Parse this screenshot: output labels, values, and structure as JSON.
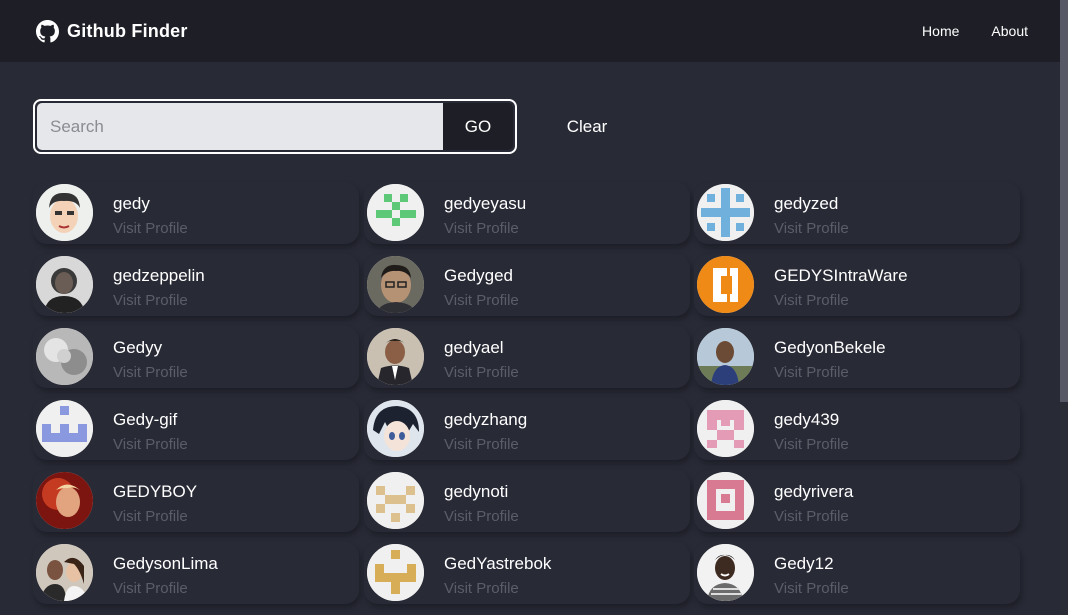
{
  "navbar": {
    "title": "Github Finder",
    "logo_icon": "github-icon",
    "links": [
      {
        "label": "Home"
      },
      {
        "label": "About"
      }
    ]
  },
  "search": {
    "placeholder": "Search",
    "value": "",
    "go_label": "GO",
    "clear_label": "Clear"
  },
  "users": [
    {
      "login": "gedy",
      "link": "Visit Profile",
      "avatar": "cartoon-face"
    },
    {
      "login": "gedyeyasu",
      "link": "Visit Profile",
      "avatar": "identicon-green"
    },
    {
      "login": "gedyzed",
      "link": "Visit Profile",
      "avatar": "identicon-blue"
    },
    {
      "login": "gedzeppelin",
      "link": "Visit Profile",
      "avatar": "photo-bw"
    },
    {
      "login": "Gedyged",
      "link": "Visit Profile",
      "avatar": "photo-portrait"
    },
    {
      "login": "GEDYSIntraWare",
      "link": "Visit Profile",
      "avatar": "logo-orange"
    },
    {
      "login": "Gedyy",
      "link": "Visit Profile",
      "avatar": "photo-grey"
    },
    {
      "login": "gedyael",
      "link": "Visit Profile",
      "avatar": "photo-suit"
    },
    {
      "login": "GedyonBekele",
      "link": "Visit Profile",
      "avatar": "photo-outdoor"
    },
    {
      "login": "Gedy-gif",
      "link": "Visit Profile",
      "avatar": "identicon-periwinkle"
    },
    {
      "login": "gedyzhang",
      "link": "Visit Profile",
      "avatar": "anime-character"
    },
    {
      "login": "gedy439",
      "link": "Visit Profile",
      "avatar": "identicon-pink"
    },
    {
      "login": "GEDYBOY",
      "link": "Visit Profile",
      "avatar": "photo-red"
    },
    {
      "login": "gedynoti",
      "link": "Visit Profile",
      "avatar": "identicon-tan"
    },
    {
      "login": "gedyrivera",
      "link": "Visit Profile",
      "avatar": "identicon-rose"
    },
    {
      "login": "GedysonLima",
      "link": "Visit Profile",
      "avatar": "photo-couple"
    },
    {
      "login": "GedYastrebok",
      "link": "Visit Profile",
      "avatar": "identicon-gold"
    },
    {
      "login": "Gedy12",
      "link": "Visit Profile",
      "avatar": "photo-smiling"
    }
  ],
  "colors": {
    "background": "#282a36",
    "navbar": "#1e1f26",
    "muted_text": "#5b5e69",
    "search_bg": "#e6e7eb"
  }
}
